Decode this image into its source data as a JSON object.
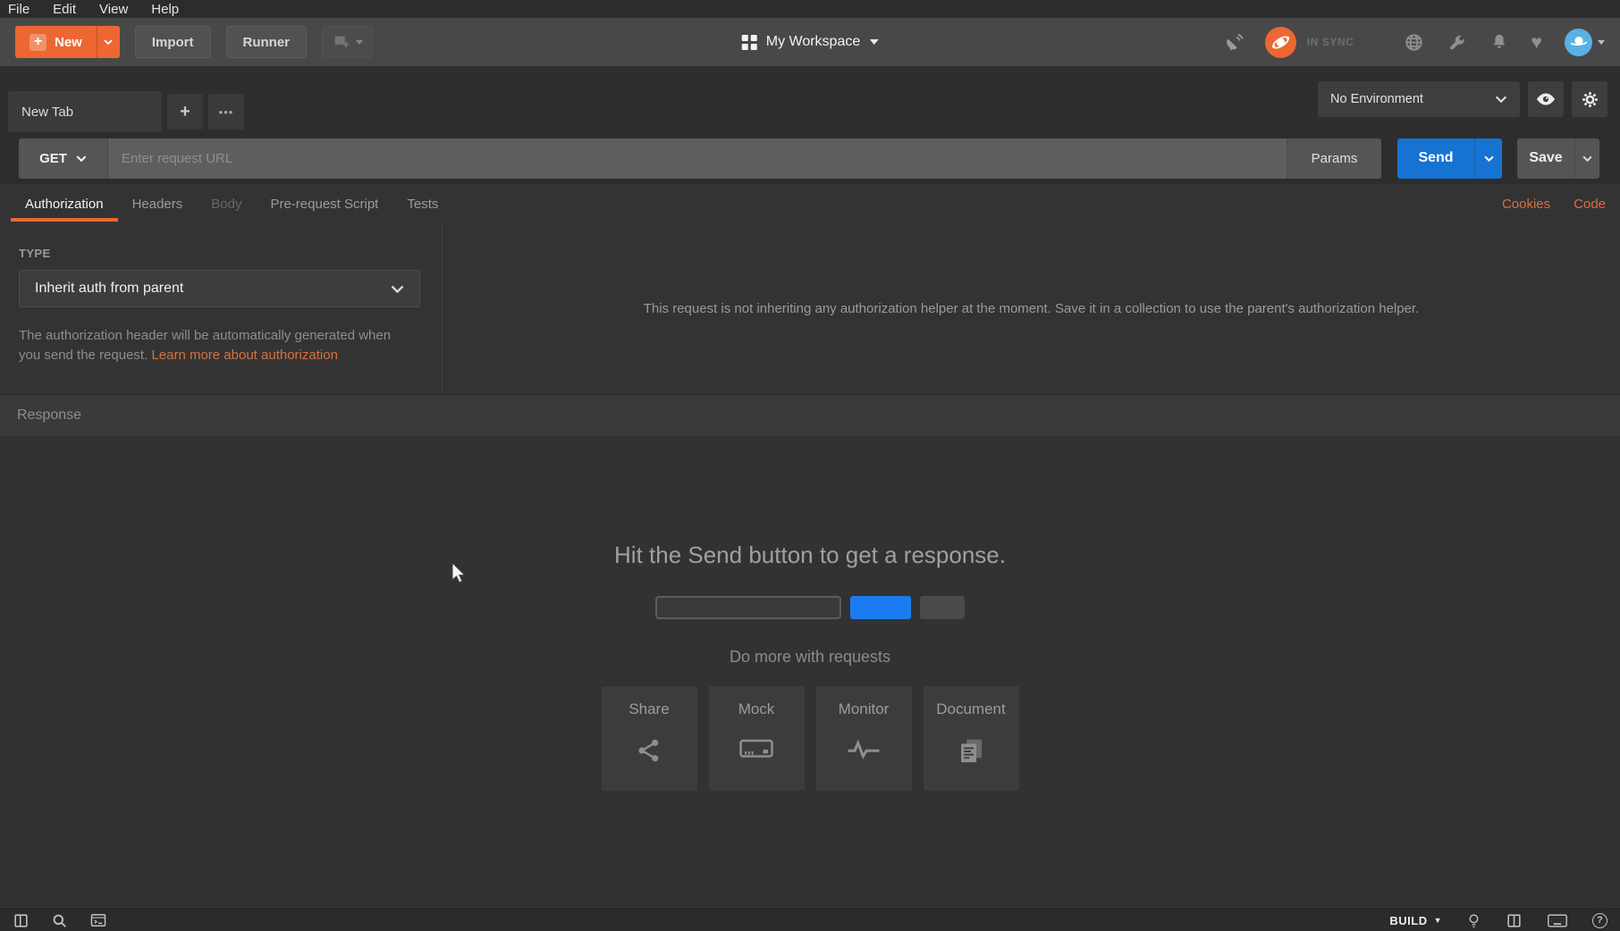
{
  "menu": {
    "items": [
      "File",
      "Edit",
      "View",
      "Help"
    ]
  },
  "toolbar": {
    "new_label": "New",
    "import_label": "Import",
    "runner_label": "Runner",
    "workspace_label": "My Workspace",
    "sync_status": "IN SYNC"
  },
  "tabs_bar": {
    "tab_title": "New Tab",
    "environment_selector": "No Environment"
  },
  "request_bar": {
    "method": "GET",
    "url_placeholder": "Enter request URL",
    "params_label": "Params",
    "send_label": "Send",
    "save_label": "Save"
  },
  "request_tabs": {
    "items": [
      "Authorization",
      "Headers",
      "Body",
      "Pre-request Script",
      "Tests"
    ],
    "active": "Authorization",
    "cookies_label": "Cookies",
    "code_label": "Code"
  },
  "authorization": {
    "type_label": "TYPE",
    "type_value": "Inherit auth from parent",
    "helper_text": "The authorization header will be automatically generated when you send the request. ",
    "helper_link": "Learn more about authorization",
    "inherit_message": "This request is not inheriting any authorization helper at the moment. Save it in a collection to use the parent's authorization helper."
  },
  "response": {
    "section_label": "Response",
    "empty_title": "Hit the Send button to get a response.",
    "do_more_label": "Do more with requests",
    "cards": [
      {
        "label": "Share"
      },
      {
        "label": "Mock"
      },
      {
        "label": "Monitor"
      },
      {
        "label": "Document"
      }
    ]
  },
  "status_bar": {
    "build_label": "BUILD"
  },
  "icons": {
    "plus_glyph": "+",
    "ellipsis_glyph": "•••",
    "heart_glyph": "♥",
    "help_glyph": "?",
    "caret_glyph": "▼"
  },
  "colors": {
    "accent_orange": "#ec6731",
    "send_blue": "#1673d2",
    "illustration_blue": "#1a7cf0",
    "avatar_blue": "#58b0e3"
  }
}
